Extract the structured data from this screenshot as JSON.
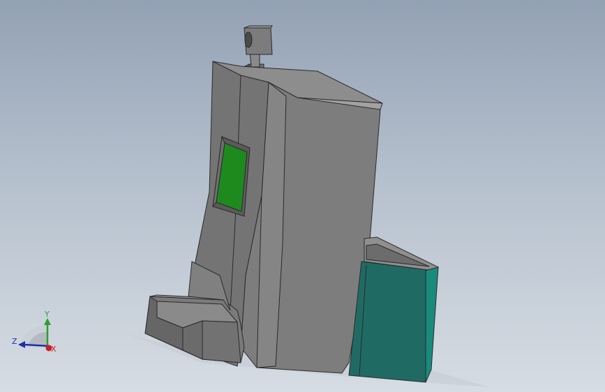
{
  "viewport": {
    "background_top": "#93a1b4",
    "background_bottom": "#d6dce3"
  },
  "model": {
    "body_color": "#7d7d7d",
    "edge_color": "#2a2a2a",
    "window_color": "#1f8a1f",
    "tank_color": "#1f6b64"
  },
  "triad": {
    "x_label": "X",
    "y_label": "Y",
    "z_label": "Z",
    "x_color": "#c8202a",
    "y_color": "#2e9e2e",
    "z_color": "#1d2fa8"
  }
}
